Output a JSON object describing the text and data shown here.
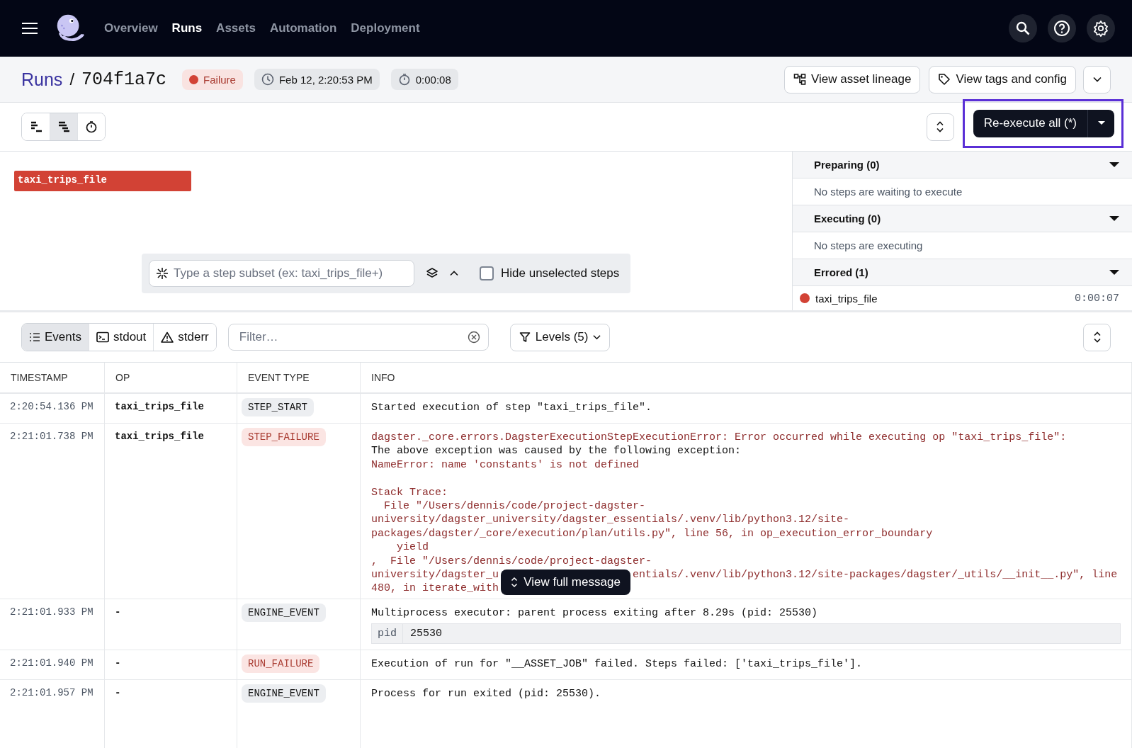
{
  "nav": {
    "items": [
      {
        "label": "Overview",
        "selected": false
      },
      {
        "label": "Runs",
        "selected": true
      },
      {
        "label": "Assets",
        "selected": false
      },
      {
        "label": "Automation",
        "selected": false
      },
      {
        "label": "Deployment",
        "selected": false
      }
    ]
  },
  "header": {
    "breadcrumb": "Runs",
    "separator": "/",
    "run_id": "704f1a7c",
    "status": {
      "label": "Failure",
      "color": "#d24235"
    },
    "started": "Feb 12, 2:20:53 PM",
    "duration": "0:00:08",
    "buttons": [
      {
        "label": "View asset lineage",
        "kind": "lineage"
      },
      {
        "label": "View tags and config",
        "kind": "tag"
      }
    ]
  },
  "toolbar": {
    "view_modes": [
      {
        "kind": "flat",
        "selected": false
      },
      {
        "kind": "waterfall",
        "selected": true
      },
      {
        "kind": "timer",
        "selected": false
      }
    ],
    "reexecute": "Re-execute all (*)",
    "highlighted": true
  },
  "gantt": {
    "steps": [
      {
        "name": "taxi_trips_file",
        "color": "#d24235"
      }
    ],
    "subset_placeholder": "Type a step subset (ex: taxi_trips_file+)",
    "hide_unselected": {
      "label": "Hide unselected steps",
      "checked": false
    }
  },
  "step_panel": {
    "sections": [
      {
        "title": "Preparing (0)",
        "expanded": true,
        "empty": "No steps are waiting to execute"
      },
      {
        "title": "Executing (0)",
        "expanded": true,
        "empty": "No steps are executing"
      },
      {
        "title": "Errored (1)",
        "expanded": true,
        "steps": [
          {
            "name": "taxi_trips_file",
            "time": "0:00:07",
            "color": "#d24235"
          }
        ]
      }
    ]
  },
  "logs": {
    "tabs": [
      {
        "label": "Events",
        "kind": "events",
        "selected": true
      },
      {
        "label": "stdout",
        "kind": "stdout",
        "selected": false
      },
      {
        "label": "stderr",
        "kind": "stderr",
        "selected": false
      }
    ],
    "filter_placeholder": "Filter…",
    "levels": "Levels (5)",
    "columns": [
      "TIMESTAMP",
      "OP",
      "EVENT TYPE",
      "INFO"
    ],
    "rows": [
      {
        "timestamp": "2:20:54.136 PM",
        "op": "taxi_trips_file",
        "event_type": "STEP_START",
        "failure": false,
        "lines": [
          {
            "parts": [
              "Started execution of step \"taxi_trips_file\"."
            ],
            "error": false
          }
        ]
      },
      {
        "timestamp": "2:21:01.738 PM",
        "op": "taxi_trips_file",
        "event_type": "STEP_FAILURE",
        "failure": true,
        "overlay": "View full message",
        "lines": [
          {
            "parts": [
              "dagster._core.errors.DagsterExecutionStepExecutionError: Error occurred while executing op \"taxi_trips_file\":"
            ],
            "error": true,
            "spaced": false
          },
          {
            "parts": [
              "The above exception was caused by the following exception:"
            ],
            "error": false
          },
          {
            "parts": [
              "NameError: name 'constants' is not defined"
            ],
            "error": true,
            "spaced": false
          },
          {
            "parts": [
              "Stack Trace:"
            ],
            "error": true,
            "spaced": true
          },
          {
            "parts": [
              "  File \"/Users/dennis/code/project-dagster-"
            ],
            "error": true,
            "spaced": false
          },
          {
            "parts": [
              "university/dagster_university/dagster_essentials/.venv/lib/python3.12/site-"
            ],
            "error": true,
            "spaced": false
          },
          {
            "parts": [
              "packages/dagster/_core/execution/plan/utils.py\", line 56, in op_execution_error_boundary"
            ],
            "error": true,
            "spaced": false
          },
          {
            "parts": [
              "    yield"
            ],
            "error": true,
            "spaced": false
          },
          {
            "parts": [
              ",  File \"/Users/dennis/code/project-dagster-"
            ],
            "error": true,
            "spaced": false
          },
          {
            "parts": [
              "university/dagster_u",
              "entials/.venv/lib/python3.12/site-packages/dagster/_utils/__init__.py\", line"
            ],
            "error": true,
            "spaced": false
          },
          {
            "parts": [
              "480, in iterate_with"
            ],
            "error": true,
            "spaced": false
          }
        ]
      },
      {
        "timestamp": "2:21:01.933 PM",
        "op": "-",
        "event_type": "ENGINE_EVENT",
        "failure": false,
        "lines": [
          {
            "parts": [
              "Multiprocess executor: parent process exiting after 8.29s (pid: 25530)"
            ],
            "error": false
          }
        ],
        "meta": [
          {
            "key": "pid",
            "value": "25530"
          }
        ]
      },
      {
        "timestamp": "2:21:01.940 PM",
        "op": "-",
        "event_type": "RUN_FAILURE",
        "failure": true,
        "lines": [
          {
            "parts": [
              "Execution of run for \"__ASSET_JOB\" failed. Steps failed: ['taxi_trips_file']."
            ],
            "error": false
          }
        ]
      },
      {
        "timestamp": "2:21:01.957 PM",
        "op": "-",
        "event_type": "ENGINE_EVENT",
        "failure": false,
        "lines": [
          {
            "parts": [
              "Process for run exited (pid: 25530)."
            ],
            "error": false
          }
        ]
      }
    ]
  }
}
